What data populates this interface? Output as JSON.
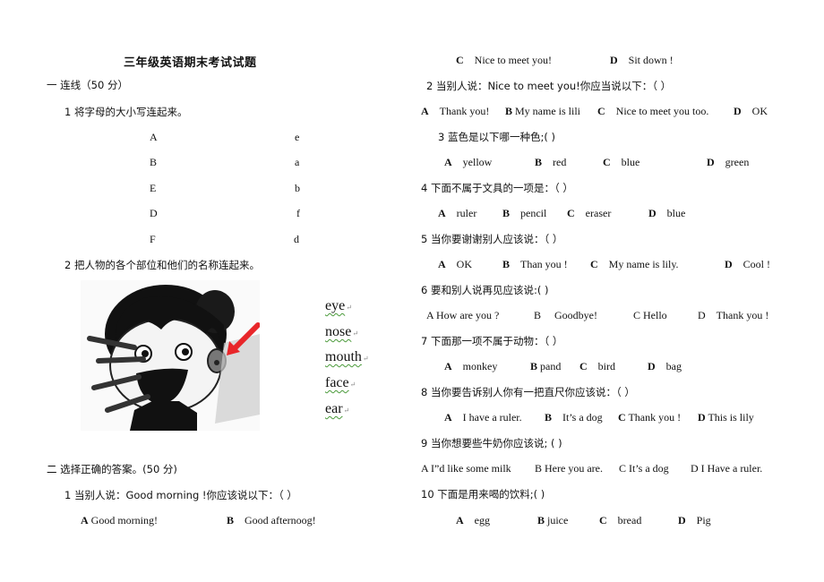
{
  "document": {
    "title": "三年级英语期末考试试题",
    "section1": {
      "heading": "一  连线（50 分）",
      "q1": {
        "prompt": "1  将字母的大小写连起来。",
        "uppercase": [
          "A",
          "B",
          "E",
          "D",
          "F"
        ],
        "lowercase": [
          "e",
          "a",
          "b",
          "f",
          "d"
        ]
      },
      "q2": {
        "prompt": "2  把人物的各个部位和他们的名称连起来。",
        "image_label": "cartoon girl with arrows pointing to body parts",
        "words": [
          "eye",
          "nose",
          "mouth",
          "face",
          "ear"
        ],
        "return_mark": "↵"
      }
    },
    "section2": {
      "heading": "二  选择正确的答案。(50 分)",
      "questions": [
        {
          "prompt": "1  当别人说：Good morning !你应该说以下：（  ）",
          "options": [
            {
              "letter": "A",
              "text": "Good morning!"
            },
            {
              "letter": "B",
              "text": "Good afternoog!"
            },
            {
              "letter": "C",
              "text": "Nice to meet you!"
            },
            {
              "letter": "D",
              "text": "Sit down !"
            }
          ]
        },
        {
          "prompt": "2  当别人说：Nice to meet you!你应当说以下：（    ）",
          "options": [
            {
              "letter": "A",
              "text": "Thank you!"
            },
            {
              "letter": "B",
              "text": "My name is lili"
            },
            {
              "letter": "C",
              "text": "Nice to meet you too."
            },
            {
              "letter": "D",
              "text": "OK"
            }
          ]
        },
        {
          "prompt": "3    蓝色是以下哪一种色;(      )",
          "options": [
            {
              "letter": "A",
              "text": "yellow"
            },
            {
              "letter": "B",
              "text": "red"
            },
            {
              "letter": "C",
              "text": "blue"
            },
            {
              "letter": "D",
              "text": "green"
            }
          ]
        },
        {
          "prompt": "4  下面不属于文具的一项是：（    ）",
          "options": [
            {
              "letter": "A",
              "text": "ruler"
            },
            {
              "letter": "B",
              "text": "pencil"
            },
            {
              "letter": "C",
              "text": "eraser"
            },
            {
              "letter": "D",
              "text": "blue"
            }
          ]
        },
        {
          "prompt": "5    当你要谢谢别人应该说：（    ）",
          "options": [
            {
              "letter": "A",
              "text": "OK"
            },
            {
              "letter": "B",
              "text": "Than you !"
            },
            {
              "letter": "C",
              "text": "My name is lily."
            },
            {
              "letter": "D",
              "text": "Cool !"
            }
          ]
        },
        {
          "prompt": "6    要和别人说再见应该说:(      )",
          "options": [
            {
              "letter": "A",
              "text": "How are you ?"
            },
            {
              "letter": "B",
              "text": "Goodbye!"
            },
            {
              "letter": "C",
              "text": "Hello"
            },
            {
              "letter": "D",
              "text": "Thank you !"
            }
          ]
        },
        {
          "prompt": "7    下面那一项不属于动物：（      ）",
          "options": [
            {
              "letter": "A",
              "text": "monkey"
            },
            {
              "letter": "B",
              "text": "pand"
            },
            {
              "letter": "C",
              "text": "bird"
            },
            {
              "letter": "D",
              "text": "bag"
            }
          ]
        },
        {
          "prompt": "8      当你要告诉别人你有一把直尺你应该说：（    ）",
          "options": [
            {
              "letter": "A",
              "text": "I have a ruler."
            },
            {
              "letter": "B",
              "text": "It’s a dog"
            },
            {
              "letter": "C",
              "text": "Thank you !"
            },
            {
              "letter": "D",
              "text": "This is lily"
            }
          ]
        },
        {
          "prompt": "9      当你想要些牛奶你应该说; (      )",
          "options": [
            {
              "letter": "A",
              "text": "I”d like some milk"
            },
            {
              "letter": "B",
              "text": "Here you are."
            },
            {
              "letter": "C",
              "text": "It’s a dog"
            },
            {
              "letter": "D",
              "text": "I Have a ruler."
            }
          ]
        },
        {
          "prompt": "10      下面是用来喝的饮料;(      )",
          "options": [
            {
              "letter": "A",
              "text": "egg"
            },
            {
              "letter": "B",
              "text": "juice"
            },
            {
              "letter": "C",
              "text": "bread"
            },
            {
              "letter": "D",
              "text": "Pig"
            }
          ]
        }
      ]
    }
  },
  "colors": {
    "arrow_red": "#e8262a",
    "squiggle_green": "#4a9a3a"
  }
}
